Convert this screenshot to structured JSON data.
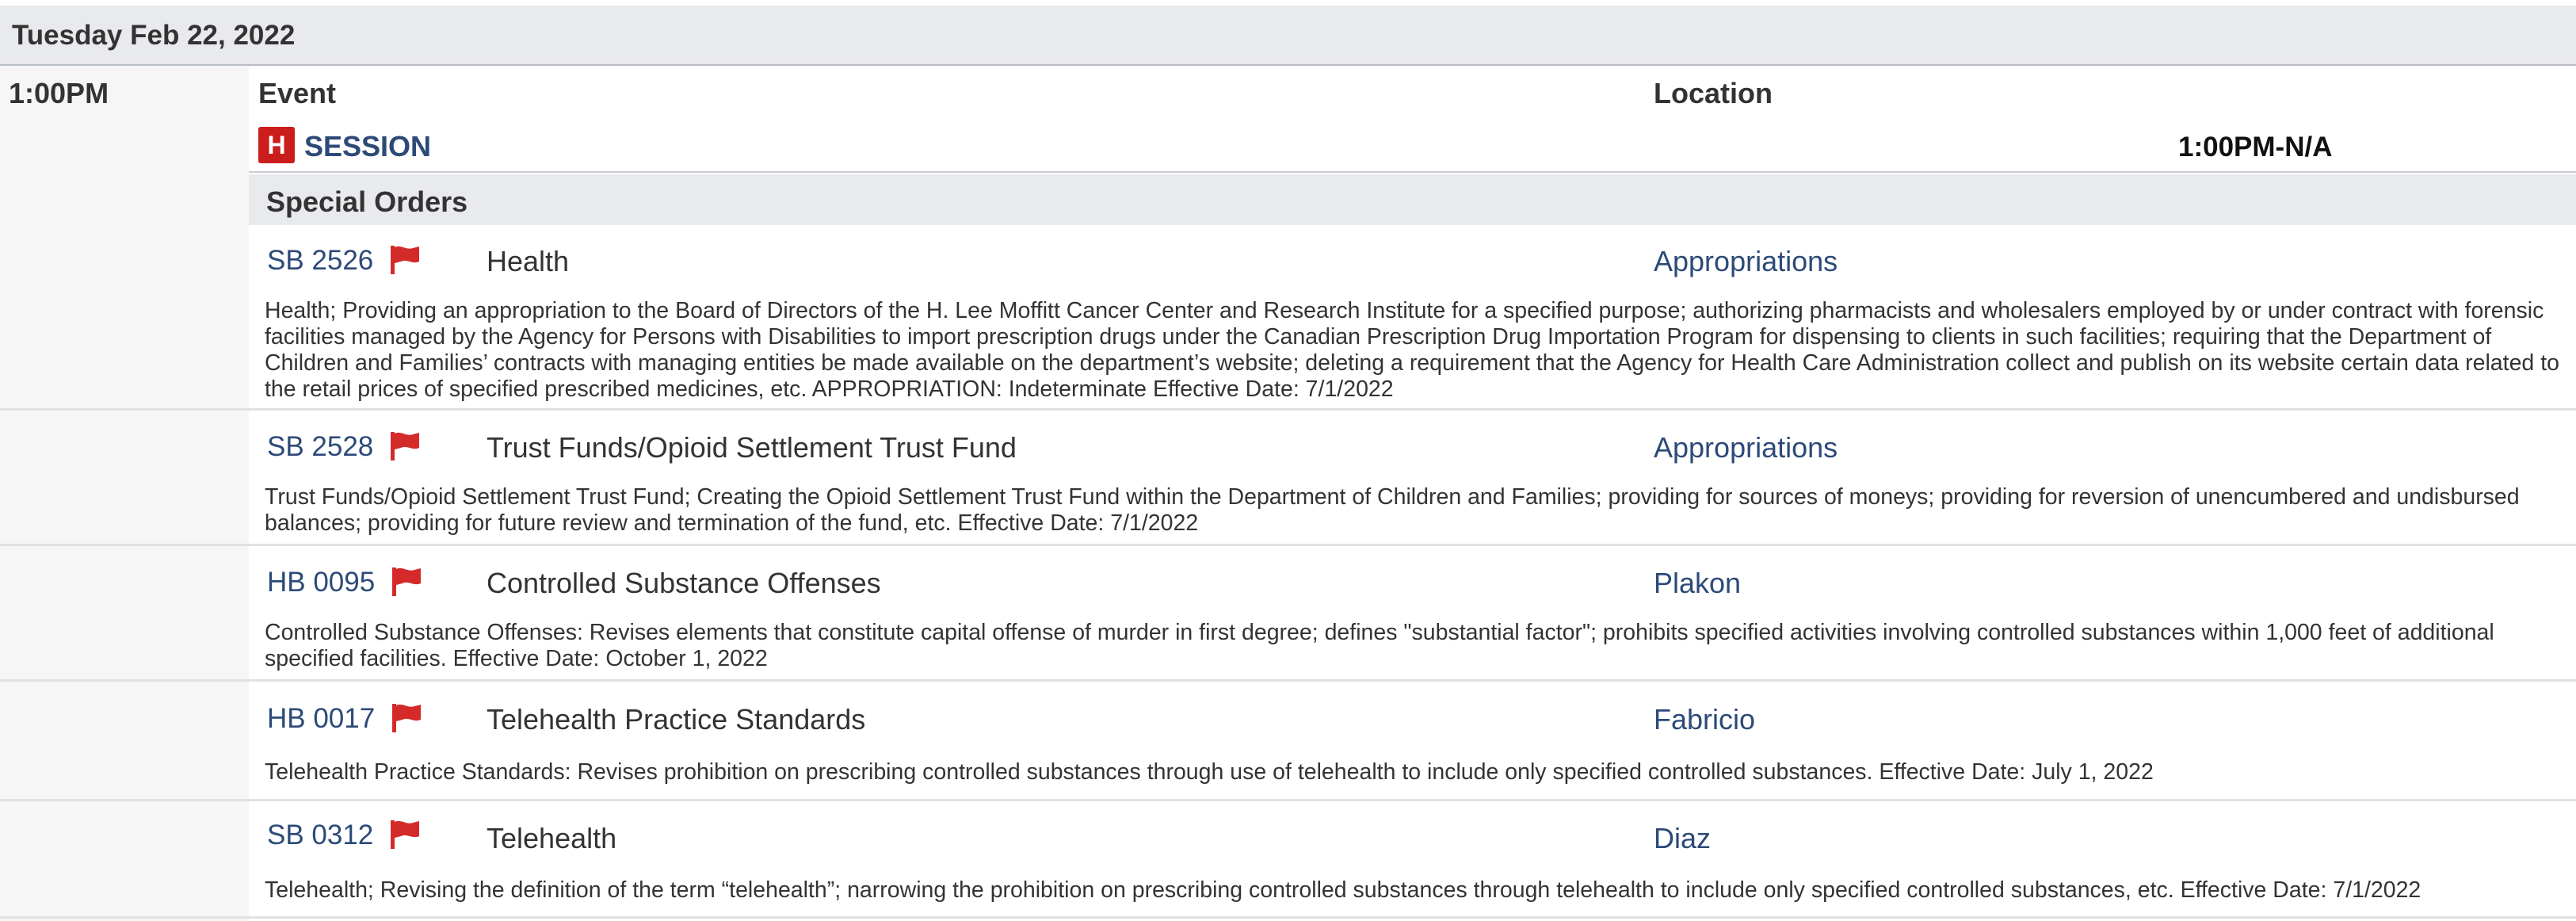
{
  "date_header": "Tuesday Feb 22, 2022",
  "time_slot": "1:00PM",
  "columns": {
    "event": "Event",
    "location": "Location"
  },
  "session": {
    "badge": "H",
    "label": "SESSION",
    "time": "1:00PM-N/A"
  },
  "group": "Special Orders",
  "bills": [
    {
      "number": "SB 2526",
      "title": "Health",
      "location": "Appropriations",
      "description": "Health; Providing an appropriation to the Board of Directors of the H. Lee Moffitt Cancer Center and Research Institute for a specified purpose; authorizing pharmacists and wholesalers employed by or under contract with forensic facilities managed by the Agency for Persons with Disabilities to import prescription drugs under the Canadian Prescription Drug Importation Program for dispensing to clients in such facilities; requiring that the Department of Children and Families’ contracts with managing entities be made available on the department’s website; deleting a requirement that the Agency for Health Care Administration collect and publish on its website certain data related to the retail prices of specified prescribed medicines, etc. APPROPRIATION: Indeterminate Effective Date: 7/1/2022"
    },
    {
      "number": "SB 2528",
      "title": "Trust Funds/Opioid Settlement Trust Fund",
      "location": "Appropriations",
      "description": "Trust Funds/Opioid Settlement Trust Fund; Creating the Opioid Settlement Trust Fund within the Department of Children and Families; providing for sources of moneys; providing for reversion of unencumbered and undisbursed balances; providing for future review and termination of the fund, etc. Effective Date: 7/1/2022"
    },
    {
      "number": "HB 0095",
      "title": "Controlled Substance Offenses",
      "location": "Plakon",
      "description": "Controlled Substance Offenses: Revises elements that constitute capital offense of murder in first degree; defines \"substantial factor\"; prohibits specified activities involving controlled substances within 1,000 feet of additional specified facilities. Effective Date: October 1, 2022"
    },
    {
      "number": "HB 0017",
      "title": "Telehealth Practice Standards",
      "location": "Fabricio",
      "description": "Telehealth Practice Standards: Revises prohibition on prescribing controlled substances through use of telehealth to include only specified controlled substances. Effective Date: July 1, 2022"
    },
    {
      "number": "SB 0312",
      "title": "Telehealth",
      "location": "Diaz",
      "description": "Telehealth; Revising the definition of the term “telehealth”; narrowing the prohibition on prescribing controlled substances through telehealth to include only specified controlled substances, etc. Effective Date: 7/1/2022"
    }
  ],
  "icons": {
    "flag": "flag-icon",
    "flag_color": "#d42a2a",
    "accent": "#2c4a78",
    "badge_color": "#cc1d1d"
  }
}
